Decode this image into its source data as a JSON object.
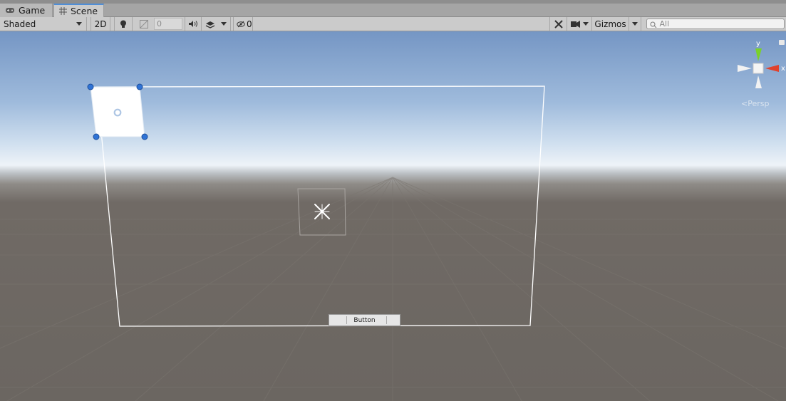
{
  "tabs": [
    {
      "label": "Game",
      "icon": "gamepad-icon"
    },
    {
      "label": "Scene",
      "icon": "grid-icon",
      "active": true
    }
  ],
  "toolbar": {
    "draw_mode": "Shaded",
    "mode_2d": "2D",
    "grid_value": "0",
    "hidden_count": "0",
    "gizmos_label": "Gizmos",
    "search_placeholder": "All"
  },
  "scene": {
    "button_label": "Button",
    "gizmo": {
      "y_label": "y",
      "x_label": "x",
      "projection": "Persp"
    }
  },
  "colors": {
    "selection_handle": "#2f73d6",
    "gizmo_y": "#7ad12a",
    "gizmo_x": "#e0412c",
    "active_tab_accent": "#4f8ed7"
  }
}
